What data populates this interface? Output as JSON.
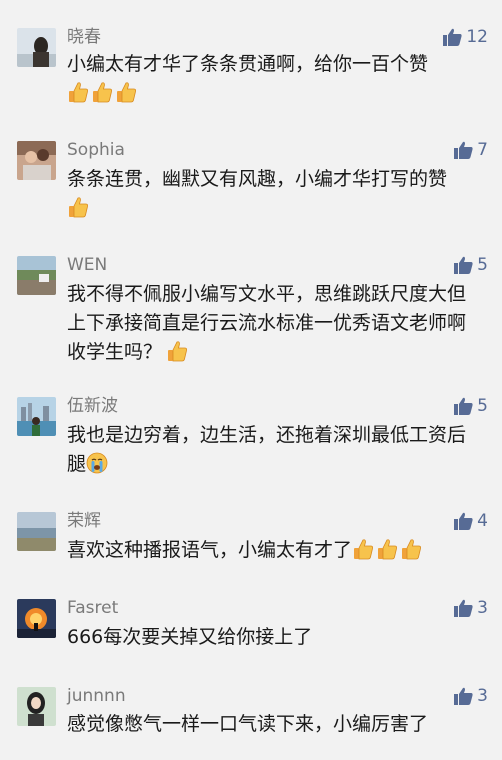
{
  "comments": [
    {
      "name": "晓春",
      "likes": "12",
      "text": "小编太有才华了条条贯通啊，给你一百个赞",
      "emojis": [
        "thumbs-up",
        "thumbs-up",
        "thumbs-up"
      ]
    },
    {
      "name": "Sophia",
      "likes": "7",
      "text": "条条连贯，幽默又有风趣，小编才华打写的赞",
      "emojis": [
        "thumbs-up"
      ]
    },
    {
      "name": "WEN",
      "likes": "5",
      "text": "我不得不佩服小编写文水平，思维跳跃尺度大但上下承接简直是行云流水标准一优秀语文老师啊收学生吗？",
      "emojis": [
        "thumbs-up"
      ]
    },
    {
      "name": "伍新波",
      "likes": "5",
      "text": "我也是边穷着，边生活，还拖着深圳最低工资后腿",
      "emojis": [
        "crying-face"
      ]
    },
    {
      "name": "荣辉",
      "likes": "4",
      "text": "喜欢这种播报语气，小编太有才了",
      "emojis": [
        "thumbs-up",
        "thumbs-up",
        "thumbs-up"
      ]
    },
    {
      "name": "Fasret",
      "likes": "3",
      "text": "666每次要关掉又给你接上了",
      "emojis": []
    },
    {
      "name": "junnnn",
      "likes": "3",
      "text": "感觉像憋气一样一口气读下来，小编厉害了",
      "emojis": []
    }
  ],
  "colors": {
    "background": "#f2f2f2",
    "name": "#7a7a7a",
    "like_accent": "#576b95",
    "text": "#1a1a1a"
  }
}
